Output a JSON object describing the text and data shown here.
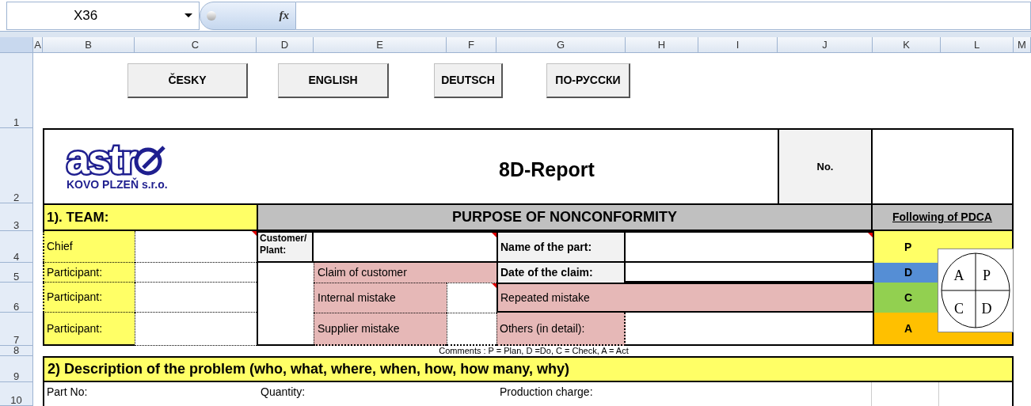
{
  "name_box": "X36",
  "formula_bar": {
    "function_label": "fx"
  },
  "columns": [
    "A",
    "B",
    "C",
    "D",
    "E",
    "F",
    "G",
    "H",
    "I",
    "J",
    "K",
    "L",
    "M"
  ],
  "rows": [
    "1",
    "2",
    "3",
    "4",
    "5",
    "6",
    "7",
    "8",
    "9",
    "10"
  ],
  "language_buttons": [
    "ČESKY",
    "ENGLISH",
    "DEUTSCH",
    "ПО-РУССКИ"
  ],
  "header": {
    "logo_wordmark": "astr",
    "company": "KOVO PLZEŇ s.r.o.",
    "title": "8D-Report",
    "number_label": "No."
  },
  "team": {
    "heading": "1). TEAM:",
    "members": [
      "Chief",
      "Participant:",
      "Participant:",
      "Participant:"
    ]
  },
  "purpose": {
    "heading": "PURPOSE OF NONCONFORMITY",
    "customer_plant_label": "Customer/Plant:",
    "claim_of_customer": "Claim of customer",
    "internal_mistake": "Internal mistake",
    "supplier_mistake": "Supplier mistake",
    "name_of_part_label": "Name of the part:",
    "date_of_claim_label": "Date of the claim:",
    "repeated_mistake": "Repeated mistake",
    "others_label": "Others (in detail):"
  },
  "pdca": {
    "heading": "Following of PDCA",
    "steps": [
      {
        "letter": "P",
        "color": "#ffff66"
      },
      {
        "letter": "D",
        "color": "#558ed5"
      },
      {
        "letter": "C",
        "color": "#92d050"
      },
      {
        "letter": "A",
        "color": "#ffc000"
      }
    ],
    "wheel": [
      "A",
      "P",
      "C",
      "D"
    ]
  },
  "comments": "Comments : P = Plan, D =Do, C = Check, A = Act",
  "description": {
    "heading": "2) Description of the problem (who, what, where, when, how, how many, why)",
    "fields": [
      "Part No:",
      "Quantity:",
      "Production charge:"
    ]
  }
}
